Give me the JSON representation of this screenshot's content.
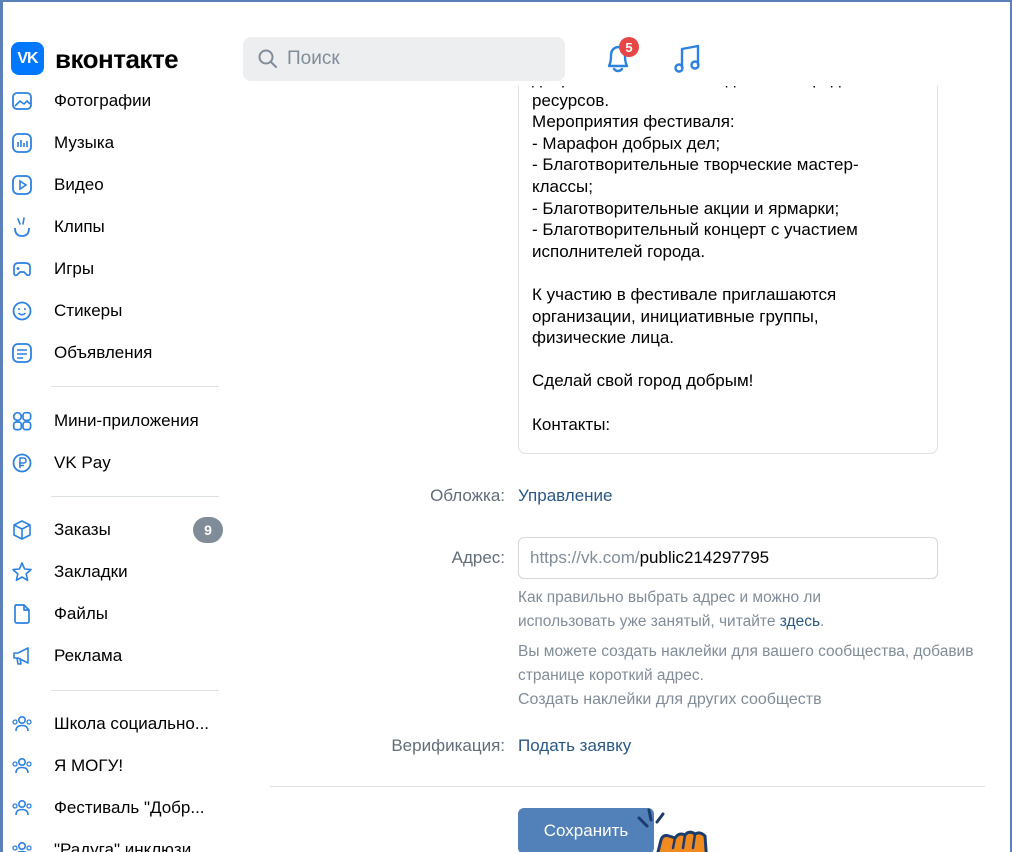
{
  "header": {
    "logo_mark": "VK",
    "logo_text": "вконтакте",
    "search_placeholder": "Поиск",
    "notifications_count": "5"
  },
  "sidebar": {
    "items": [
      {
        "label": "Фотографии",
        "icon": "photo-icon"
      },
      {
        "label": "Музыка",
        "icon": "music-icon"
      },
      {
        "label": "Видео",
        "icon": "video-icon"
      },
      {
        "label": "Клипы",
        "icon": "clips-icon"
      },
      {
        "label": "Игры",
        "icon": "games-icon"
      },
      {
        "label": "Стикеры",
        "icon": "stickers-icon"
      },
      {
        "label": "Объявления",
        "icon": "ads-icon"
      },
      {
        "label": "Мини-приложения",
        "icon": "mini-apps-icon"
      },
      {
        "label": "VK Pay",
        "icon": "vkpay-icon"
      },
      {
        "label": "Заказы",
        "icon": "orders-icon",
        "badge": "9"
      },
      {
        "label": "Закладки",
        "icon": "bookmarks-icon"
      },
      {
        "label": "Файлы",
        "icon": "files-icon"
      },
      {
        "label": "Реклама",
        "icon": "advertising-icon"
      },
      {
        "label": "Школа социально...",
        "icon": "community-icon"
      },
      {
        "label": "Я МОГУ!",
        "icon": "community-icon"
      },
      {
        "label": "Фестиваль \"Добр...",
        "icon": "community-icon"
      },
      {
        "label": "\"Радуга\" инклюзи...",
        "icon": "community-icon"
      }
    ]
  },
  "main": {
    "description_text": "добровольчество и объединение городских\nресурсов.\nМероприятия фестиваля:\n- Марафон добрых дел;\n- Благотворительные творческие мастер-\nклассы;\n- Благотворительные акции и ярмарки;\n- Благотворительный концерт с участием\nисполнителей города.\n\nК участию в фестивале приглашаются\nорганизации, инициативные группы,\nфизические лица.\n\nСделай свой город добрым!\n\nКонтакты:",
    "cover_label": "Обложка:",
    "cover_link": "Управление",
    "address_label": "Адрес:",
    "address_prefix": "https://vk.com/",
    "address_value": "public214297795",
    "address_hint_text": "Как правильно выбрать адрес и можно ли использовать уже занятый, читайте ",
    "address_hint_link": "здесь",
    "address_hint_end": ".",
    "stickers_hint": "Вы можете создать наклейки для вашего сообщества, добавив странице короткий адрес.",
    "stickers_link": "Создать наклейки для других сообществ",
    "verification_label": "Верификация:",
    "verification_link": "Подать заявку",
    "save_button": "Сохранить"
  },
  "colors": {
    "brand": "#0077ff",
    "link": "#2a5885",
    "button": "#5181b8",
    "badge_red": "#e64646",
    "cursor_hand": "#f28b1f"
  }
}
